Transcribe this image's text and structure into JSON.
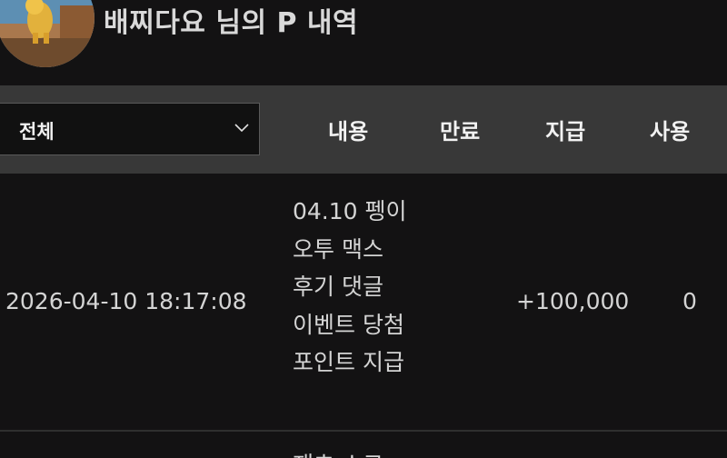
{
  "header": {
    "title": "배찌다요 님의 P 내역"
  },
  "table": {
    "filter": {
      "selected": "전체"
    },
    "columns": {
      "content": "내용",
      "expire": "만료",
      "paid": "지급",
      "used": "사용"
    },
    "rows": [
      {
        "date": "2026-04-10 18:17:08",
        "content": "04.10 펭이 오투 맥스 후기 댓글 이벤트 당첨 포인트 지급",
        "paid": "+100,000",
        "used": "0"
      },
      {
        "content": "재초 스코"
      }
    ]
  },
  "icons": {
    "filter_chevron": "chevron-down-icon",
    "avatar": "avatar"
  },
  "colors": {
    "background": "#131213",
    "header_bar": "#383838",
    "text": "#d4d4d4"
  }
}
